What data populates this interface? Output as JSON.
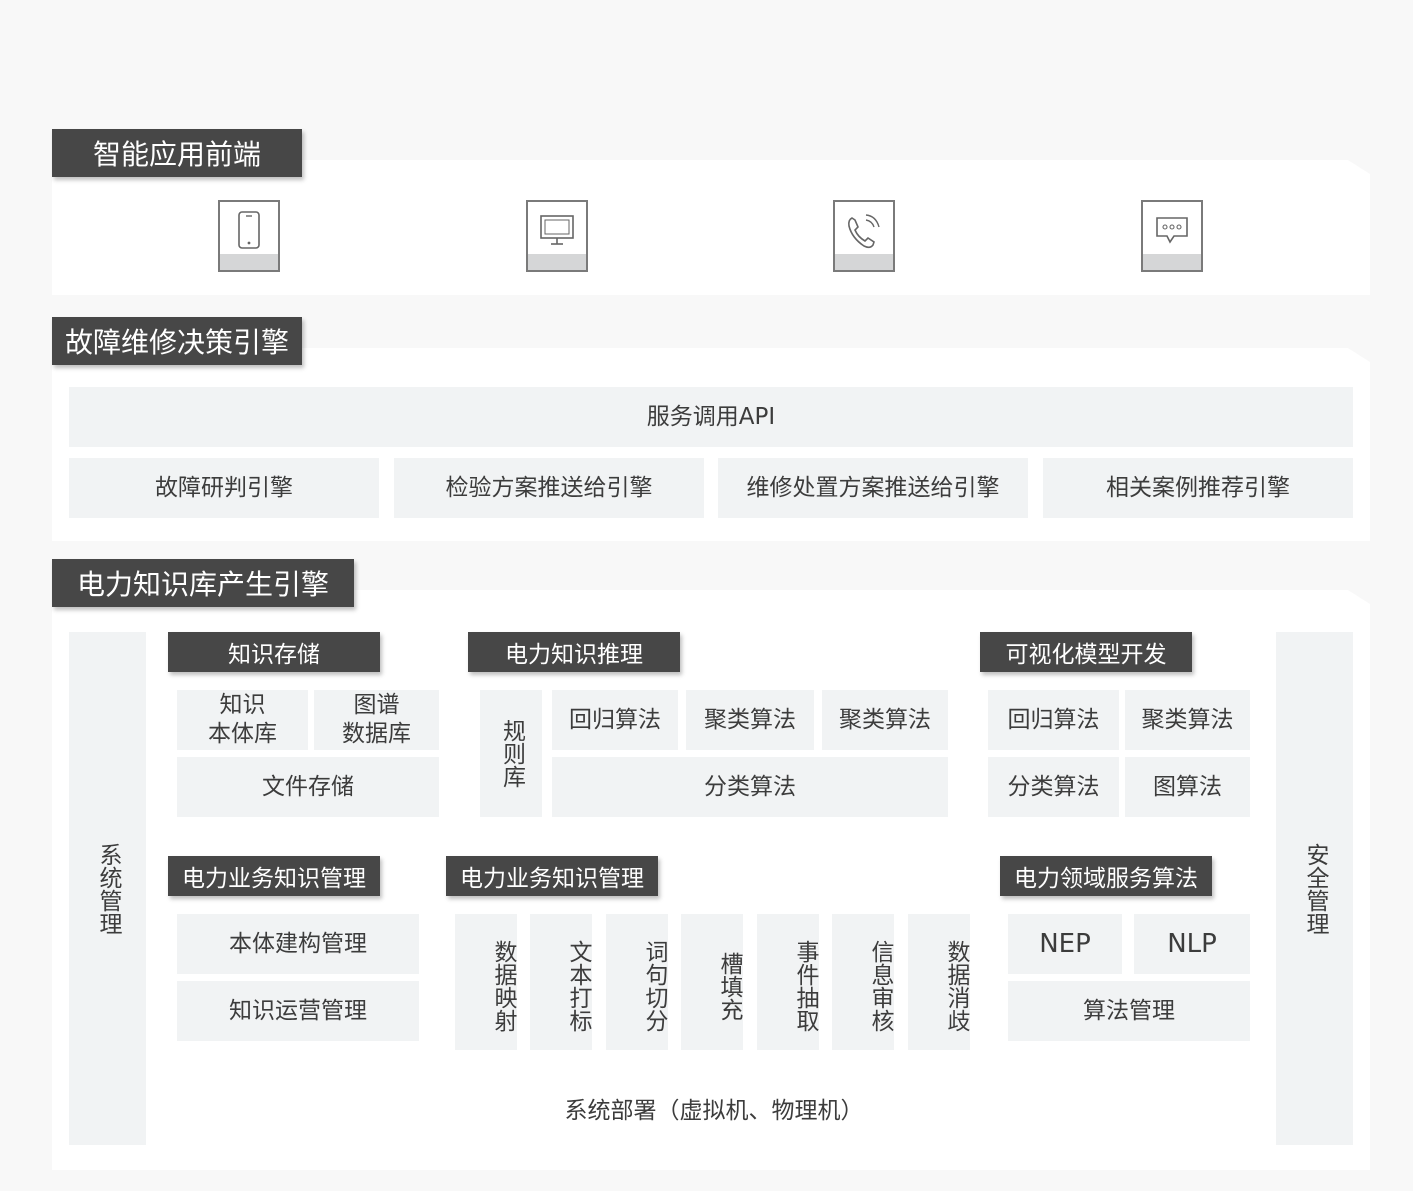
{
  "front": {
    "title": "智能应用前端",
    "icons": [
      "phone-icon",
      "monitor-icon",
      "call-icon",
      "chat-bubble-icon"
    ]
  },
  "fault": {
    "title": "故障维修决策引擎",
    "api": "服务调用API",
    "engines": [
      "故障研判引擎",
      "检验方案推送给引擎",
      "维修处置方案推送给引擎",
      "相关案例推荐引擎"
    ]
  },
  "knowledge": {
    "title": "电力知识库产生引擎",
    "left_side": "系统管理",
    "right_side": "安全管理",
    "storage": {
      "title": "知识存储",
      "ontology": "知识\n本体库",
      "graph_db": "图谱\n数据库",
      "file": "文件存储"
    },
    "reasoning": {
      "title": "电力知识推理",
      "rules": "规则库",
      "algo1": "回归算法",
      "algo2": "聚类算法",
      "algo3": "聚类算法",
      "algo4": "分类算法"
    },
    "visual": {
      "title": "可视化模型开发",
      "algo1": "回归算法",
      "algo2": "聚类算法",
      "algo3": "分类算法",
      "algo4": "图算法"
    },
    "biz_mgmt_a": {
      "title": "电力业务知识管理",
      "item1": "本体建构管理",
      "item2": "知识运营管理"
    },
    "biz_mgmt_b": {
      "title": "电力业务知识管理",
      "items": [
        "数据映射",
        "文本打标",
        "词句切分",
        "槽填充",
        "事件抽取",
        "信息审核",
        "数据消歧"
      ]
    },
    "domain_algo": {
      "title": "电力领域服务算法",
      "nep": "NEP",
      "nlp": "NLP",
      "mgmt": "算法管理"
    },
    "deploy": "系统部署（虚拟机、物理机）"
  }
}
